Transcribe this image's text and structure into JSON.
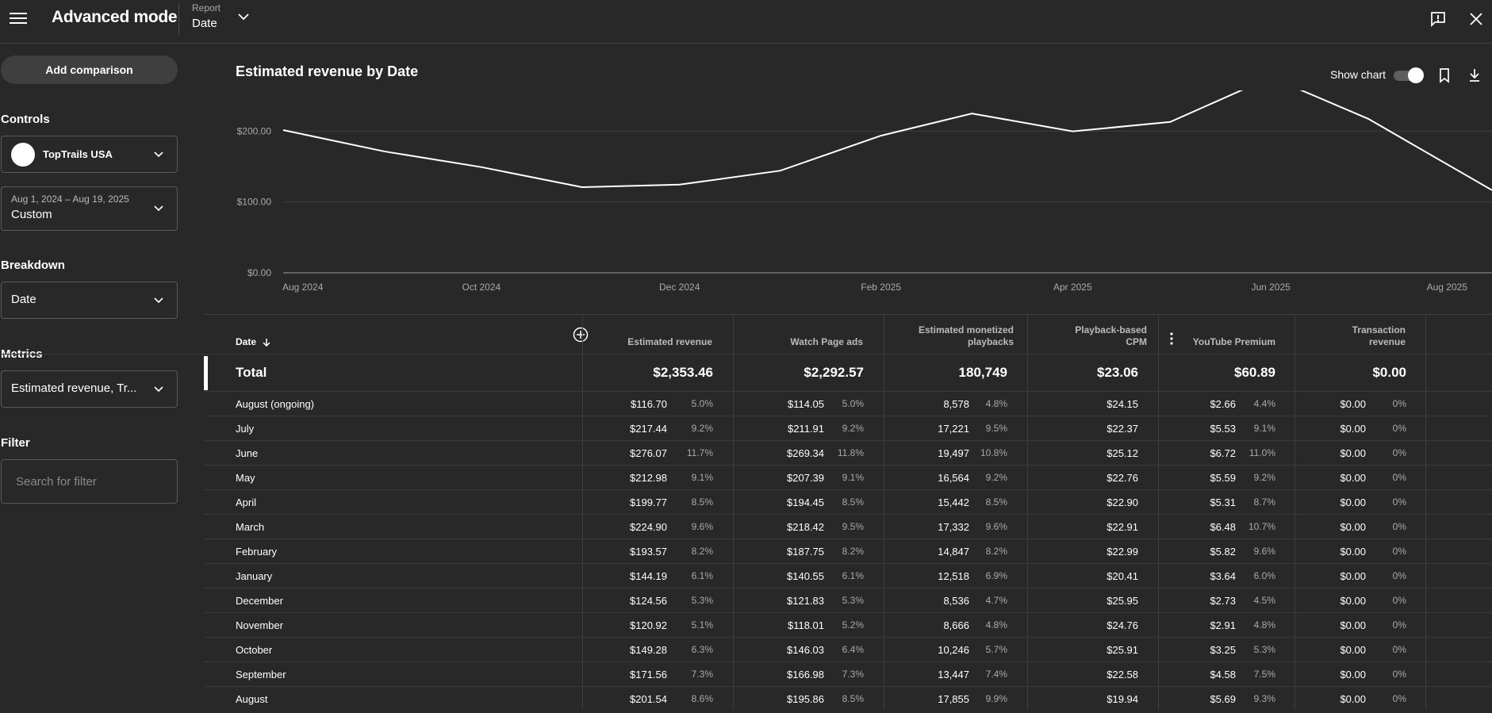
{
  "topbar": {
    "app_title": "Advanced mode",
    "report_label": "Report",
    "report_value": "Date"
  },
  "sidebar": {
    "add_comparison": "Add comparison",
    "controls_heading": "Controls",
    "channel_name": "TopTrails USA",
    "date_range": "Aug 1, 2024 – Aug 19, 2025",
    "date_preset": "Custom",
    "breakdown_heading": "Breakdown",
    "breakdown_value": "Date",
    "metrics_heading": "Metrics",
    "metrics_value": "Estimated revenue, Tr...",
    "filter_heading": "Filter",
    "filter_placeholder": "Search for filter"
  },
  "chart_header": {
    "title": "Estimated revenue by Date",
    "show_chart_label": "Show chart"
  },
  "chart_data": {
    "type": "line",
    "x": [
      "2024-08-01",
      "2024-09-01",
      "2024-10-01",
      "2024-11-01",
      "2024-12-01",
      "2025-01-01",
      "2025-02-01",
      "2025-03-01",
      "2025-04-01",
      "2025-05-01",
      "2025-06-01",
      "2025-07-01",
      "2025-08-19"
    ],
    "values": [
      201.54,
      171.56,
      149.28,
      120.92,
      124.56,
      144.19,
      193.57,
      224.9,
      199.77,
      212.98,
      276.07,
      217.44,
      116.7
    ],
    "x_tick_labels": [
      "Aug 2024",
      "Oct 2024",
      "Dec 2024",
      "Feb 2025",
      "Apr 2025",
      "Jun 2025",
      "Aug 2025"
    ],
    "y_ticks": [
      0,
      100,
      200
    ],
    "y_tick_labels": [
      "$0.00",
      "$100.00",
      "$200.00"
    ],
    "ylim": [
      0,
      262
    ],
    "grid": true,
    "line_color": "#ffffff"
  },
  "table": {
    "headers": [
      "Date",
      "Estimated revenue",
      "Watch Page ads",
      "Estimated monetized playbacks",
      "Playback-based CPM",
      "YouTube Premium",
      "Transaction revenue"
    ],
    "total": {
      "label": "Total",
      "values": [
        "$2,353.46",
        "$2,292.57",
        "180,749",
        "$23.06",
        "$60.89",
        "$0.00"
      ]
    },
    "rows": [
      {
        "date": "August (ongoing)",
        "rev": "$116.70",
        "rev_pct": "5.0%",
        "wpa": "$114.05",
        "wpa_pct": "5.0%",
        "mp": "8,578",
        "mp_pct": "4.8%",
        "cpm": "$24.15",
        "yp": "$2.66",
        "yp_pct": "4.4%",
        "tr": "$0.00",
        "tr_pct": "0%"
      },
      {
        "date": "July",
        "rev": "$217.44",
        "rev_pct": "9.2%",
        "wpa": "$211.91",
        "wpa_pct": "9.2%",
        "mp": "17,221",
        "mp_pct": "9.5%",
        "cpm": "$22.37",
        "yp": "$5.53",
        "yp_pct": "9.1%",
        "tr": "$0.00",
        "tr_pct": "0%"
      },
      {
        "date": "June",
        "rev": "$276.07",
        "rev_pct": "11.7%",
        "wpa": "$269.34",
        "wpa_pct": "11.8%",
        "mp": "19,497",
        "mp_pct": "10.8%",
        "cpm": "$25.12",
        "yp": "$6.72",
        "yp_pct": "11.0%",
        "tr": "$0.00",
        "tr_pct": "0%"
      },
      {
        "date": "May",
        "rev": "$212.98",
        "rev_pct": "9.1%",
        "wpa": "$207.39",
        "wpa_pct": "9.1%",
        "mp": "16,564",
        "mp_pct": "9.2%",
        "cpm": "$22.76",
        "yp": "$5.59",
        "yp_pct": "9.2%",
        "tr": "$0.00",
        "tr_pct": "0%"
      },
      {
        "date": "April",
        "rev": "$199.77",
        "rev_pct": "8.5%",
        "wpa": "$194.45",
        "wpa_pct": "8.5%",
        "mp": "15,442",
        "mp_pct": "8.5%",
        "cpm": "$22.90",
        "yp": "$5.31",
        "yp_pct": "8.7%",
        "tr": "$0.00",
        "tr_pct": "0%"
      },
      {
        "date": "March",
        "rev": "$224.90",
        "rev_pct": "9.6%",
        "wpa": "$218.42",
        "wpa_pct": "9.5%",
        "mp": "17,332",
        "mp_pct": "9.6%",
        "cpm": "$22.91",
        "yp": "$6.48",
        "yp_pct": "10.7%",
        "tr": "$0.00",
        "tr_pct": "0%"
      },
      {
        "date": "February",
        "rev": "$193.57",
        "rev_pct": "8.2%",
        "wpa": "$187.75",
        "wpa_pct": "8.2%",
        "mp": "14,847",
        "mp_pct": "8.2%",
        "cpm": "$22.99",
        "yp": "$5.82",
        "yp_pct": "9.6%",
        "tr": "$0.00",
        "tr_pct": "0%"
      },
      {
        "date": "January",
        "rev": "$144.19",
        "rev_pct": "6.1%",
        "wpa": "$140.55",
        "wpa_pct": "6.1%",
        "mp": "12,518",
        "mp_pct": "6.9%",
        "cpm": "$20.41",
        "yp": "$3.64",
        "yp_pct": "6.0%",
        "tr": "$0.00",
        "tr_pct": "0%"
      },
      {
        "date": "December",
        "rev": "$124.56",
        "rev_pct": "5.3%",
        "wpa": "$121.83",
        "wpa_pct": "5.3%",
        "mp": "8,536",
        "mp_pct": "4.7%",
        "cpm": "$25.95",
        "yp": "$2.73",
        "yp_pct": "4.5%",
        "tr": "$0.00",
        "tr_pct": "0%"
      },
      {
        "date": "November",
        "rev": "$120.92",
        "rev_pct": "5.1%",
        "wpa": "$118.01",
        "wpa_pct": "5.2%",
        "mp": "8,666",
        "mp_pct": "4.8%",
        "cpm": "$24.76",
        "yp": "$2.91",
        "yp_pct": "4.8%",
        "tr": "$0.00",
        "tr_pct": "0%"
      },
      {
        "date": "October",
        "rev": "$149.28",
        "rev_pct": "6.3%",
        "wpa": "$146.03",
        "wpa_pct": "6.4%",
        "mp": "10,246",
        "mp_pct": "5.7%",
        "cpm": "$25.91",
        "yp": "$3.25",
        "yp_pct": "5.3%",
        "tr": "$0.00",
        "tr_pct": "0%"
      },
      {
        "date": "September",
        "rev": "$171.56",
        "rev_pct": "7.3%",
        "wpa": "$166.98",
        "wpa_pct": "7.3%",
        "mp": "13,447",
        "mp_pct": "7.4%",
        "cpm": "$22.58",
        "yp": "$4.58",
        "yp_pct": "7.5%",
        "tr": "$0.00",
        "tr_pct": "0%"
      },
      {
        "date": "August",
        "rev": "$201.54",
        "rev_pct": "8.6%",
        "wpa": "$195.86",
        "wpa_pct": "8.5%",
        "mp": "17,855",
        "mp_pct": "9.9%",
        "cpm": "$19.94",
        "yp": "$5.69",
        "yp_pct": "9.3%",
        "tr": "$0.00",
        "tr_pct": "0%"
      }
    ]
  }
}
